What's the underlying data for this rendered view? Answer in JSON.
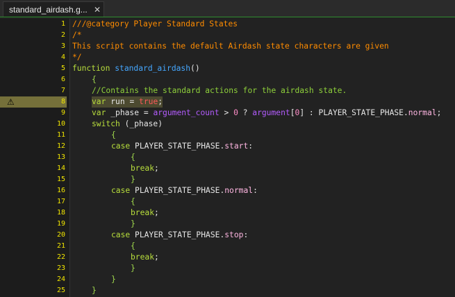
{
  "tab": {
    "title": "standard_airdash.g...",
    "close_glyph": "✕"
  },
  "warning_line": 8,
  "colors": {
    "comment": "#ff8c00",
    "keyword": "#b8de3c",
    "function": "#45a7ff",
    "line_number": "#f2e600",
    "warning_highlight": "#75703a"
  },
  "lines": [
    {
      "n": "1",
      "indent": 0,
      "tokens": [
        [
          "c-cmt",
          "///@category Player Standard States"
        ]
      ]
    },
    {
      "n": "2",
      "indent": 0,
      "tokens": [
        [
          "c-cmt",
          "/*"
        ]
      ]
    },
    {
      "n": "3",
      "indent": 0,
      "tokens": [
        [
          "c-cmt",
          "This script contains the default Airdash state characters are given"
        ]
      ]
    },
    {
      "n": "4",
      "indent": 0,
      "tokens": [
        [
          "c-cmt",
          "*/"
        ]
      ]
    },
    {
      "n": "5",
      "indent": 0,
      "tokens": [
        [
          "c-kw",
          "function "
        ],
        [
          "c-fn",
          "standard_airdash"
        ],
        [
          "c-op",
          "()"
        ]
      ]
    },
    {
      "n": "6",
      "indent": 1,
      "tokens": [
        [
          "c-brace",
          "{"
        ]
      ]
    },
    {
      "n": "7",
      "indent": 1,
      "tokens": [
        [
          "c-cmt2",
          "//Contains the standard actions for the airdash state."
        ]
      ]
    },
    {
      "n": "8",
      "indent": 1,
      "tokens": [
        [
          "c-kw",
          "var "
        ],
        [
          "c-id",
          "run "
        ],
        [
          "c-op",
          "= "
        ],
        [
          "c-true",
          "true"
        ],
        [
          "c-op",
          ";"
        ]
      ]
    },
    {
      "n": "9",
      "indent": 1,
      "tokens": [
        [
          "c-kw",
          "var "
        ],
        [
          "c-id",
          "_phase "
        ],
        [
          "c-op",
          "= "
        ],
        [
          "c-builtin",
          "argument_count"
        ],
        [
          "c-op",
          " > "
        ],
        [
          "c-num",
          "0"
        ],
        [
          "c-op",
          " ? "
        ],
        [
          "c-builtin",
          "argument"
        ],
        [
          "c-op",
          "["
        ],
        [
          "c-num",
          "0"
        ],
        [
          "c-op",
          "] : "
        ],
        [
          "c-const",
          "PLAYER_STATE_PHASE."
        ],
        [
          "c-field",
          "normal"
        ],
        [
          "c-op",
          ";"
        ]
      ]
    },
    {
      "n": "10",
      "indent": 1,
      "tokens": [
        [
          "c-kw",
          "switch "
        ],
        [
          "c-op",
          "(_phase)"
        ]
      ]
    },
    {
      "n": "11",
      "indent": 2,
      "tokens": [
        [
          "c-brace",
          "{"
        ]
      ]
    },
    {
      "n": "12",
      "indent": 2,
      "tokens": [
        [
          "c-kw",
          "case "
        ],
        [
          "c-const",
          "PLAYER_STATE_PHASE."
        ],
        [
          "c-field",
          "start"
        ],
        [
          "c-op",
          ":"
        ]
      ]
    },
    {
      "n": "13",
      "indent": 3,
      "tokens": [
        [
          "c-brace",
          "{"
        ]
      ]
    },
    {
      "n": "14",
      "indent": 3,
      "tokens": [
        [
          "c-kw",
          "break"
        ],
        [
          "c-op",
          ";"
        ]
      ]
    },
    {
      "n": "15",
      "indent": 3,
      "tokens": [
        [
          "c-brace",
          "}"
        ]
      ]
    },
    {
      "n": "16",
      "indent": 2,
      "tokens": [
        [
          "c-kw",
          "case "
        ],
        [
          "c-const",
          "PLAYER_STATE_PHASE."
        ],
        [
          "c-field",
          "normal"
        ],
        [
          "c-op",
          ":"
        ]
      ]
    },
    {
      "n": "17",
      "indent": 3,
      "tokens": [
        [
          "c-brace",
          "{"
        ]
      ]
    },
    {
      "n": "18",
      "indent": 3,
      "tokens": [
        [
          "c-kw",
          "break"
        ],
        [
          "c-op",
          ";"
        ]
      ]
    },
    {
      "n": "19",
      "indent": 3,
      "tokens": [
        [
          "c-brace",
          "}"
        ]
      ]
    },
    {
      "n": "20",
      "indent": 2,
      "tokens": [
        [
          "c-kw",
          "case "
        ],
        [
          "c-const",
          "PLAYER_STATE_PHASE."
        ],
        [
          "c-field",
          "stop"
        ],
        [
          "c-op",
          ":"
        ]
      ]
    },
    {
      "n": "21",
      "indent": 3,
      "tokens": [
        [
          "c-brace",
          "{"
        ]
      ]
    },
    {
      "n": "22",
      "indent": 3,
      "tokens": [
        [
          "c-kw",
          "break"
        ],
        [
          "c-op",
          ";"
        ]
      ]
    },
    {
      "n": "23",
      "indent": 3,
      "tokens": [
        [
          "c-brace",
          "}"
        ]
      ]
    },
    {
      "n": "24",
      "indent": 2,
      "tokens": [
        [
          "c-brace",
          "}"
        ]
      ]
    },
    {
      "n": "25",
      "indent": 1,
      "tokens": [
        [
          "c-brace",
          "}"
        ]
      ]
    }
  ]
}
